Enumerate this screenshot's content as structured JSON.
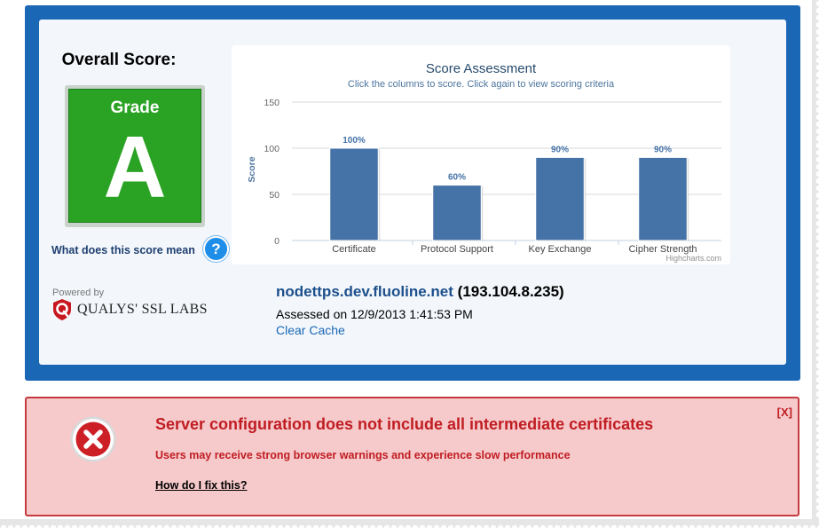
{
  "overall": {
    "title": "Overall Score:",
    "grade_label": "Grade",
    "grade": "A"
  },
  "score_help": {
    "link": "What does this score mean",
    "icon": "?"
  },
  "powered": {
    "label": "Powered by",
    "brand": "QUALYS' SSL LABS"
  },
  "host": {
    "name": "nodettps.dev.fluoline.net",
    "ip": "(193.104.8.235)",
    "assessed": "Assessed on 12/9/2013 1:41:53 PM",
    "clear_cache": "Clear Cache"
  },
  "chart_data": {
    "type": "bar",
    "title": "Score Assessment",
    "subtitle": "Click the columns to score. Click again to view scoring criteria",
    "ylabel": "Score",
    "ylim": [
      0,
      150
    ],
    "yticks": [
      0,
      50,
      100,
      150
    ],
    "categories": [
      "Certificate",
      "Protocol Support",
      "Key Exchange",
      "Cipher Strength"
    ],
    "values": [
      100,
      60,
      90,
      90
    ],
    "data_labels": [
      "100%",
      "60%",
      "90%",
      "90%"
    ],
    "credit": "Highcharts.com",
    "bar_color": "#4572a7",
    "grid": true
  },
  "warning": {
    "close": "[X]",
    "title": "Server configuration does not include all intermediate certificates",
    "subtitle": "Users may receive strong browser warnings and experience slow performance",
    "link": "How do I fix this?",
    "icon": "error-x-icon"
  },
  "colors": {
    "panel": "#1a67b6",
    "grade": "#2aa324",
    "warning_bg": "#f6c9cb",
    "warning_text": "#c01d22"
  }
}
